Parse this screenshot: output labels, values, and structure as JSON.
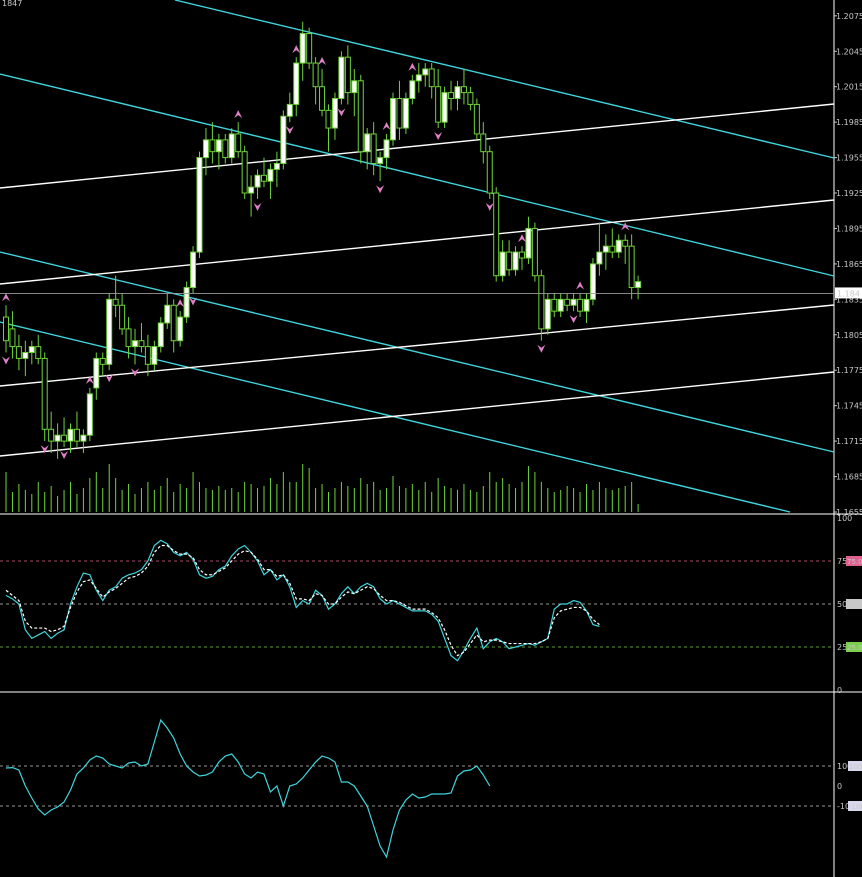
{
  "header": {
    "symbol_label": "1847"
  },
  "colors": {
    "background": "#000000",
    "bull_body": "#ffffff",
    "bear_body": "#000000",
    "candle_wick": "#6fd43a",
    "volume": "#6fd43a",
    "channel_cyan": "#3fd4dc",
    "channel_white": "#ffffff",
    "fractal": "#e080c8",
    "stoch_main": "#3fd4dc",
    "stoch_signal": "#ffffff",
    "level_high": "#e06090",
    "level_low": "#7ad04a",
    "axis_text": "#c8c8c8",
    "separator": "#ffffff"
  },
  "chart_data": [
    {
      "type": "candlestick",
      "panel": "price",
      "price_ylim": [
        1.1655,
        1.2085
      ],
      "y_ticks": [
        "1.2075",
        "1.2045",
        "1.2015",
        "1.1985",
        "1.1955",
        "1.1925",
        "1.1895",
        "1.1865",
        "1.1835",
        "1.1805",
        "1.1775",
        "1.1745",
        "1.1715",
        "1.1685",
        "1.1655"
      ],
      "current_price_label": "1.184",
      "candles": [
        [
          1.182,
          1.183,
          1.179,
          1.18
        ],
        [
          1.181,
          1.1825,
          1.1785,
          1.1795
        ],
        [
          1.1795,
          1.1805,
          1.1775,
          1.1785
        ],
        [
          1.1785,
          1.18,
          1.177,
          1.179
        ],
        [
          1.179,
          1.18,
          1.178,
          1.1795
        ],
        [
          1.1795,
          1.1805,
          1.178,
          1.1785
        ],
        [
          1.1785,
          1.179,
          1.1715,
          1.1725
        ],
        [
          1.1725,
          1.174,
          1.1705,
          1.1715
        ],
        [
          1.1715,
          1.173,
          1.17,
          1.172
        ],
        [
          1.172,
          1.1735,
          1.171,
          1.1715
        ],
        [
          1.1715,
          1.173,
          1.1705,
          1.1725
        ],
        [
          1.1725,
          1.174,
          1.171,
          1.1715
        ],
        [
          1.1715,
          1.1725,
          1.1705,
          1.172
        ],
        [
          1.172,
          1.176,
          1.1715,
          1.1755
        ],
        [
          1.176,
          1.179,
          1.175,
          1.1785
        ],
        [
          1.1785,
          1.179,
          1.177,
          1.178
        ],
        [
          1.178,
          1.184,
          1.1775,
          1.1835
        ],
        [
          1.1835,
          1.1855,
          1.182,
          1.183
        ],
        [
          1.183,
          1.184,
          1.1805,
          1.181
        ],
        [
          1.181,
          1.182,
          1.1785,
          1.1795
        ],
        [
          1.1795,
          1.181,
          1.178,
          1.18
        ],
        [
          1.18,
          1.1815,
          1.179,
          1.1795
        ],
        [
          1.1795,
          1.1805,
          1.177,
          1.178
        ],
        [
          1.178,
          1.18,
          1.1775,
          1.1795
        ],
        [
          1.1795,
          1.182,
          1.179,
          1.1815
        ],
        [
          1.1815,
          1.184,
          1.181,
          1.183
        ],
        [
          1.183,
          1.1835,
          1.179,
          1.18
        ],
        [
          1.18,
          1.1825,
          1.1795,
          1.182
        ],
        [
          1.182,
          1.185,
          1.1815,
          1.1845
        ],
        [
          1.1845,
          1.188,
          1.184,
          1.1875
        ],
        [
          1.1875,
          1.196,
          1.187,
          1.1955
        ],
        [
          1.1955,
          1.198,
          1.194,
          1.197
        ],
        [
          1.197,
          1.1985,
          1.195,
          1.196
        ],
        [
          1.196,
          1.1975,
          1.1945,
          1.197
        ],
        [
          1.197,
          1.1975,
          1.195,
          1.1955
        ],
        [
          1.1955,
          1.198,
          1.195,
          1.1975
        ],
        [
          1.1975,
          1.1985,
          1.1955,
          1.196
        ],
        [
          1.196,
          1.1965,
          1.192,
          1.1925
        ],
        [
          1.1925,
          1.194,
          1.1905,
          1.193
        ],
        [
          1.193,
          1.1945,
          1.192,
          1.194
        ],
        [
          1.194,
          1.1955,
          1.193,
          1.1935
        ],
        [
          1.1935,
          1.195,
          1.192,
          1.1945
        ],
        [
          1.1945,
          1.196,
          1.193,
          1.195
        ],
        [
          1.195,
          1.1995,
          1.1945,
          1.199
        ],
        [
          1.199,
          1.201,
          1.1985,
          1.2
        ],
        [
          1.2,
          1.204,
          1.199,
          1.2035
        ],
        [
          1.2035,
          1.207,
          1.202,
          1.206
        ],
        [
          1.206,
          1.2065,
          1.203,
          1.2035
        ],
        [
          1.2035,
          1.204,
          1.2,
          1.2015
        ],
        [
          1.2015,
          1.203,
          1.199,
          1.1995
        ],
        [
          1.1995,
          1.2,
          1.196,
          1.198
        ],
        [
          1.198,
          1.201,
          1.197,
          1.2005
        ],
        [
          1.2005,
          1.2045,
          1.2,
          1.204
        ],
        [
          1.204,
          1.205,
          1.2,
          1.201
        ],
        [
          1.201,
          1.203,
          1.199,
          1.202
        ],
        [
          1.202,
          1.2025,
          1.195,
          1.196
        ],
        [
          1.196,
          1.198,
          1.1945,
          1.1975
        ],
        [
          1.1975,
          1.1985,
          1.194,
          1.195
        ],
        [
          1.195,
          1.196,
          1.1935,
          1.1955
        ],
        [
          1.1955,
          1.1975,
          1.1945,
          1.197
        ],
        [
          1.197,
          1.201,
          1.1965,
          1.2005
        ],
        [
          1.2005,
          1.202,
          1.197,
          1.198
        ],
        [
          1.198,
          1.201,
          1.1975,
          1.2005
        ],
        [
          1.2005,
          1.2025,
          1.2,
          1.202
        ],
        [
          1.202,
          1.2035,
          1.201,
          1.2025
        ],
        [
          1.2025,
          1.2035,
          1.2015,
          1.203
        ],
        [
          1.203,
          1.2035,
          1.2005,
          1.2015
        ],
        [
          1.2015,
          1.203,
          1.198,
          1.1985
        ],
        [
          1.1985,
          1.2015,
          1.198,
          1.201
        ],
        [
          1.201,
          1.202,
          1.1995,
          1.2005
        ],
        [
          1.2005,
          1.202,
          1.1995,
          1.2015
        ],
        [
          1.2015,
          1.203,
          1.2,
          1.201
        ],
        [
          1.201,
          1.2015,
          1.1995,
          1.2
        ],
        [
          1.2,
          1.2005,
          1.197,
          1.1975
        ],
        [
          1.1975,
          1.1985,
          1.195,
          1.196
        ],
        [
          1.196,
          1.1965,
          1.192,
          1.1925
        ],
        [
          1.1925,
          1.193,
          1.185,
          1.1855
        ],
        [
          1.1855,
          1.1885,
          1.185,
          1.1875
        ],
        [
          1.1875,
          1.1885,
          1.1855,
          1.186
        ],
        [
          1.186,
          1.188,
          1.1855,
          1.1875
        ],
        [
          1.1875,
          1.188,
          1.186,
          1.187
        ],
        [
          1.187,
          1.1905,
          1.1865,
          1.1895
        ],
        [
          1.1895,
          1.19,
          1.185,
          1.1855
        ],
        [
          1.1855,
          1.186,
          1.18,
          1.181
        ],
        [
          1.181,
          1.184,
          1.1805,
          1.1835
        ],
        [
          1.1835,
          1.184,
          1.182,
          1.1825
        ],
        [
          1.1825,
          1.184,
          1.182,
          1.1835
        ],
        [
          1.1835,
          1.184,
          1.1825,
          1.183
        ],
        [
          1.183,
          1.184,
          1.1825,
          1.1835
        ],
        [
          1.1835,
          1.184,
          1.182,
          1.1825
        ],
        [
          1.1825,
          1.184,
          1.1815,
          1.1835
        ],
        [
          1.1835,
          1.187,
          1.183,
          1.1865
        ],
        [
          1.1865,
          1.19,
          1.1855,
          1.1875
        ],
        [
          1.1875,
          1.189,
          1.186,
          1.188
        ],
        [
          1.188,
          1.1895,
          1.187,
          1.1875
        ],
        [
          1.1875,
          1.189,
          1.187,
          1.1885
        ],
        [
          1.1885,
          1.189,
          1.1865,
          1.188
        ],
        [
          1.188,
          1.189,
          1.1835,
          1.1845
        ],
        [
          1.1845,
          1.1855,
          1.1835,
          1.185
        ]
      ],
      "volume": [
        40,
        20,
        28,
        22,
        18,
        30,
        20,
        26,
        16,
        22,
        30,
        18,
        24,
        34,
        40,
        24,
        48,
        34,
        22,
        28,
        18,
        24,
        30,
        22,
        26,
        34,
        20,
        28,
        24,
        40,
        30,
        24,
        22,
        26,
        22,
        24,
        20,
        30,
        28,
        24,
        26,
        34,
        28,
        40,
        30,
        30,
        48,
        44,
        24,
        28,
        20,
        24,
        30,
        26,
        24,
        34,
        28,
        30,
        22,
        24,
        36,
        26,
        24,
        28,
        22,
        30,
        20,
        34,
        26,
        24,
        22,
        28,
        22,
        20,
        26,
        40,
        30,
        34,
        28,
        24,
        30,
        46,
        40,
        30,
        24,
        20,
        22,
        26,
        24,
        20,
        28,
        22,
        30,
        24,
        22,
        24,
        26,
        30,
        8
      ],
      "fractals_up": [
        0,
        13,
        27,
        36,
        45,
        49,
        59,
        63,
        80,
        89,
        96
      ],
      "fractals_down": [
        0,
        6,
        9,
        16,
        20,
        29,
        39,
        44,
        52,
        58,
        67,
        75,
        83,
        88
      ]
    },
    {
      "type": "line",
      "panel": "stochastic",
      "ylim": [
        0,
        100
      ],
      "y_ticks": [
        "100",
        "75",
        "50",
        "25",
        "0"
      ],
      "level_labels": [
        "75.00",
        "50.00",
        "25.00"
      ],
      "levels": [
        75,
        50,
        25
      ],
      "series": [
        {
          "values": [
            55,
            53,
            50,
            35,
            30,
            32,
            34,
            30,
            33,
            35,
            50,
            60,
            68,
            67,
            58,
            52,
            58,
            60,
            65,
            67,
            68,
            70,
            75,
            84,
            87,
            85,
            80,
            78,
            80,
            76,
            67,
            65,
            66,
            70,
            72,
            78,
            82,
            84,
            80,
            75,
            67,
            70,
            64,
            67,
            60,
            48,
            52,
            50,
            58,
            55,
            47,
            50,
            56,
            60,
            56,
            60,
            62,
            60,
            53,
            50,
            52,
            50,
            48,
            46,
            46,
            46,
            44,
            40,
            30,
            20,
            17,
            23,
            30,
            36,
            24,
            28,
            30,
            28,
            24,
            25,
            26,
            27,
            26,
            28,
            30,
            47,
            50,
            50,
            52,
            51,
            46,
            38,
            37
          ]
        },
        {
          "values": [
            58,
            55,
            52,
            40,
            36,
            36,
            36,
            34,
            35,
            37,
            48,
            57,
            63,
            64,
            59,
            54,
            57,
            59,
            62,
            65,
            66,
            68,
            72,
            80,
            84,
            84,
            81,
            79,
            79,
            77,
            70,
            67,
            67,
            69,
            71,
            75,
            79,
            81,
            80,
            76,
            70,
            70,
            66,
            67,
            62,
            53,
            53,
            52,
            56,
            55,
            50,
            50,
            54,
            57,
            56,
            58,
            60,
            59,
            55,
            52,
            52,
            51,
            49,
            47,
            47,
            47,
            45,
            42,
            35,
            26,
            20,
            22,
            27,
            32,
            28,
            29,
            29,
            28,
            27,
            27,
            27,
            27,
            27,
            28,
            30,
            42,
            46,
            47,
            48,
            48,
            46,
            41,
            38
          ]
        }
      ]
    },
    {
      "type": "line",
      "panel": "cci",
      "y_ticks": [
        "100",
        "0",
        "-100"
      ],
      "level_labels": [
        "100.00",
        "-100.00"
      ],
      "levels": [
        100,
        -100
      ],
      "series": [
        {
          "values": [
            90,
            92,
            80,
            0,
            -60,
            -115,
            -145,
            -120,
            -105,
            -80,
            -20,
            60,
            90,
            130,
            150,
            140,
            110,
            100,
            90,
            115,
            120,
            100,
            110,
            220,
            330,
            290,
            240,
            160,
            100,
            70,
            50,
            55,
            70,
            120,
            150,
            160,
            120,
            60,
            40,
            70,
            60,
            -30,
            0,
            -100,
            0,
            10,
            40,
            80,
            120,
            150,
            140,
            120,
            20,
            20,
            0,
            -50,
            -100,
            -200,
            -300,
            -355,
            -220,
            -120,
            -70,
            -40,
            -60,
            -55,
            -40,
            -40,
            -40,
            -35,
            50,
            75,
            80,
            100,
            55,
            0
          ]
        }
      ]
    }
  ]
}
